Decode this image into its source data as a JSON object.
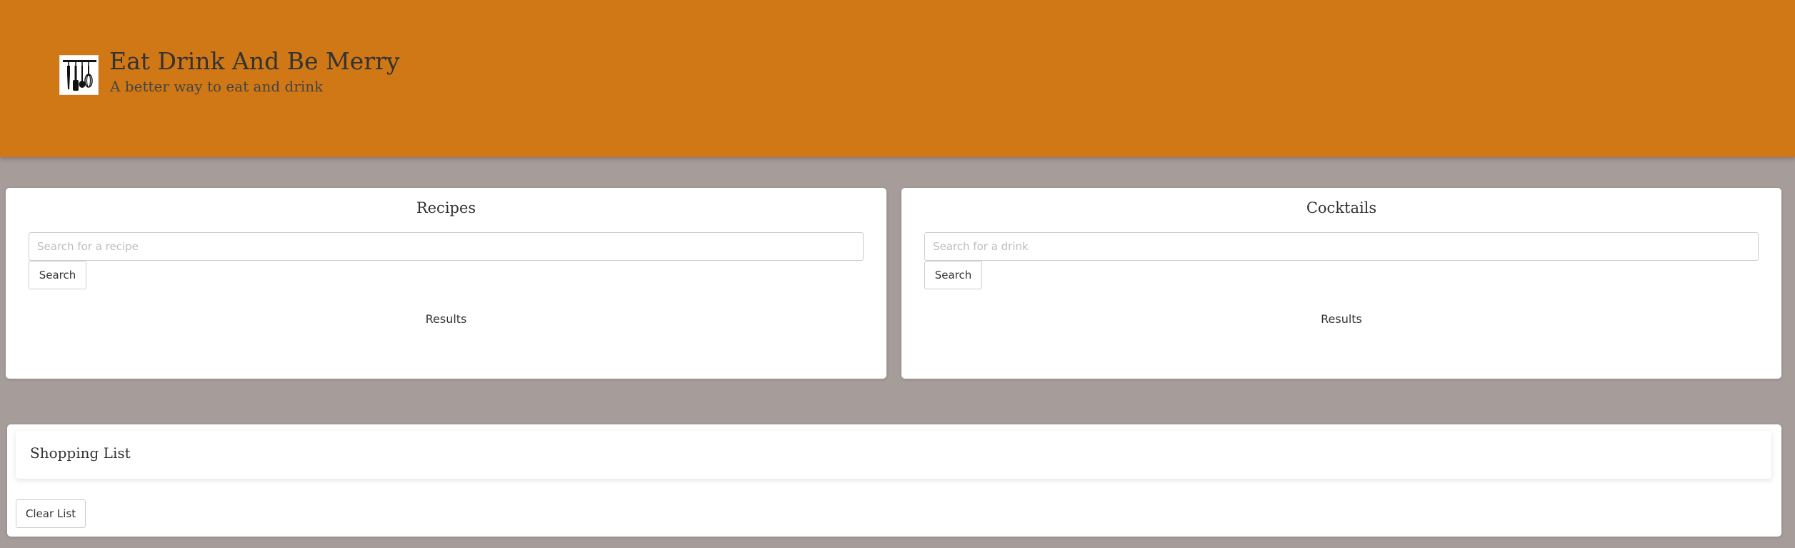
{
  "header": {
    "logo_icon": "kitchen-utensils-icon",
    "title": "Eat Drink And Be Merry",
    "subtitle": "A better way to eat and drink",
    "background_color": "#d07716"
  },
  "page": {
    "background_color": "#a69c99"
  },
  "recipes": {
    "title": "Recipes",
    "search_placeholder": "Search for a recipe",
    "search_value": "",
    "search_button": "Search",
    "results_label": "Results"
  },
  "cocktails": {
    "title": "Cocktails",
    "search_placeholder": "Search for a drink",
    "search_value": "",
    "search_button": "Search",
    "results_label": "Results"
  },
  "shopping_list": {
    "title": "Shopping List",
    "clear_button": "Clear List"
  }
}
